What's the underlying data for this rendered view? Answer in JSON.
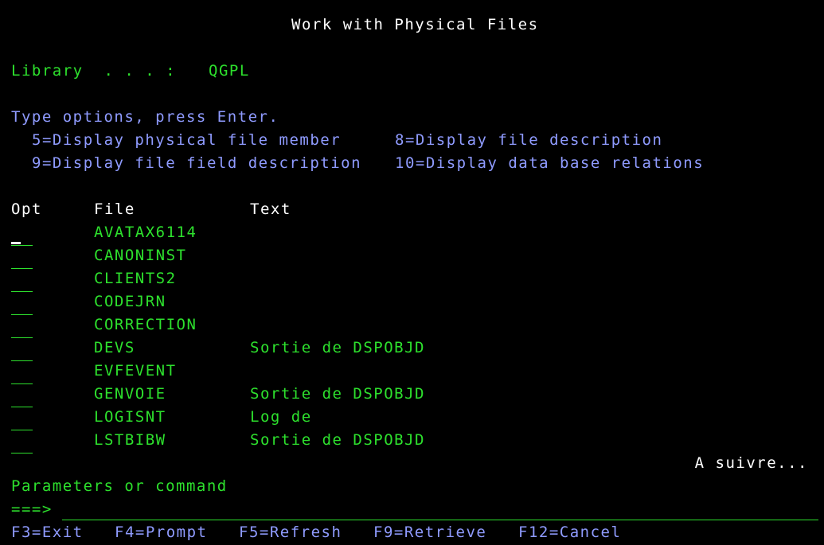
{
  "title": "Work with Physical Files",
  "library": {
    "label": "Library  . . . :",
    "value": "QGPL"
  },
  "instructions": {
    "prompt": "Type options, press Enter.",
    "options": [
      "5=Display physical file member",
      "8=Display file description",
      "9=Display file field description",
      "10=Display data base relations"
    ]
  },
  "columns": {
    "opt": "Opt",
    "file": "File",
    "text": "Text"
  },
  "rows": [
    {
      "file": "AVATAX6114",
      "text": ""
    },
    {
      "file": "CANONINST",
      "text": ""
    },
    {
      "file": "CLIENTS2",
      "text": ""
    },
    {
      "file": "CODEJRN",
      "text": ""
    },
    {
      "file": "CORRECTION",
      "text": ""
    },
    {
      "file": "DEVS",
      "text": "Sortie de DSPOBJD"
    },
    {
      "file": "EVFEVENT",
      "text": ""
    },
    {
      "file": "GENVOIE",
      "text": "Sortie de DSPOBJD"
    },
    {
      "file": "LOGISNT",
      "text": "Log de"
    },
    {
      "file": "LSTBIBW",
      "text": "Sortie de DSPOBJD"
    }
  ],
  "more": "A suivre...",
  "command": {
    "label": "Parameters or command",
    "arrow": "===>",
    "value": ""
  },
  "function_keys": [
    "F3=Exit",
    "F4=Prompt",
    "F5=Refresh",
    "F9=Retrieve",
    "F12=Cancel"
  ],
  "colors": {
    "background": "#000000",
    "green": "#2de02d",
    "blue": "#8f9bff",
    "white": "#ffffff"
  }
}
